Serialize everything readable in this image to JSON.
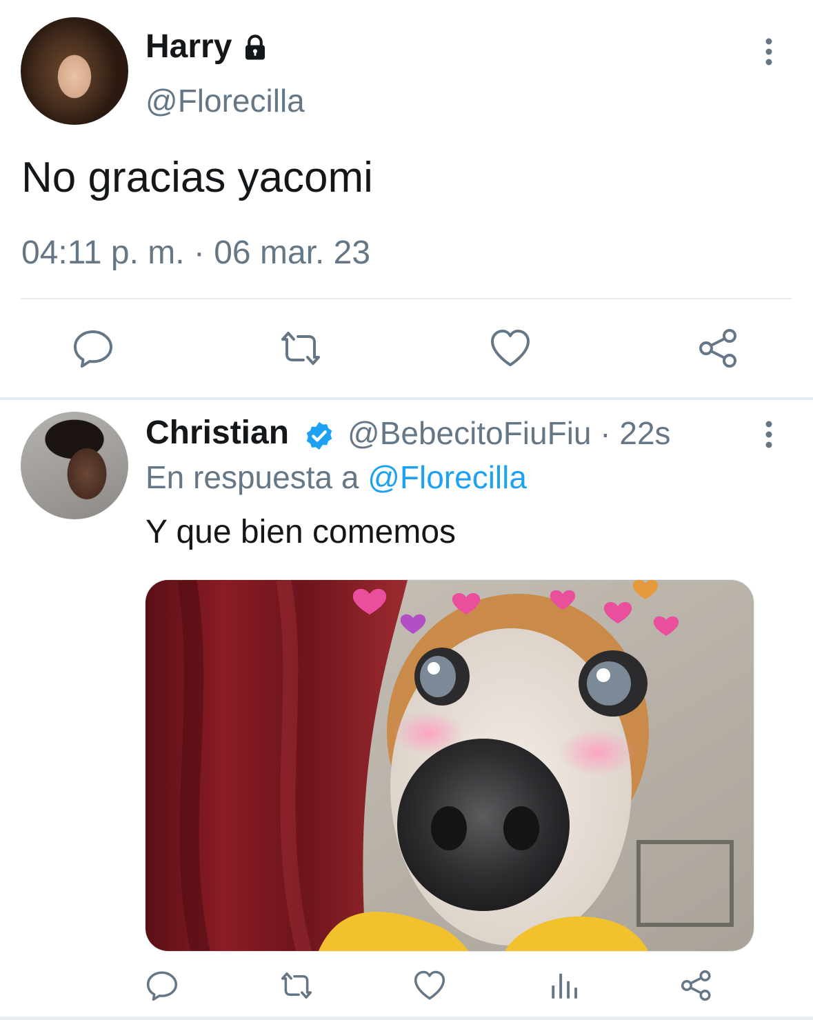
{
  "main_tweet": {
    "display_name": "Harry",
    "handle": "@Florecilla",
    "text": "No gracias yacomi",
    "timestamp": "04:11 p. m. · 06 mar. 23",
    "protected_icon": "lock-icon",
    "more_icon": "more-vertical-icon",
    "actions": [
      "reply-icon",
      "retweet-icon",
      "like-icon",
      "share-icon"
    ]
  },
  "reply_tweet": {
    "display_name": "Christian",
    "verified_icon": "verified-badge-icon",
    "handle_time": "@BebecitoFiuFiu · 22s",
    "reply_prefix": "En respuesta a",
    "reply_mention": "@Florecilla",
    "text": "Y que bien comemos",
    "media": "dog-meme-image",
    "more_icon": "more-vertical-icon",
    "actions": [
      "reply-icon",
      "retweet-icon",
      "like-icon",
      "analytics-icon",
      "share-icon"
    ]
  },
  "colors": {
    "text_primary": "#14171a",
    "text_secondary": "#657786",
    "link": "#1da1f2",
    "divider": "#e6ecf0",
    "verified": "#1da1f2"
  }
}
